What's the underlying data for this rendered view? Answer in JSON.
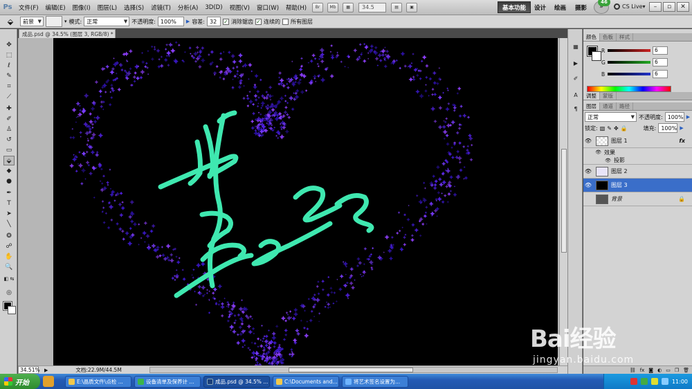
{
  "app": {
    "logo": "Ps"
  },
  "menu": {
    "items": [
      "文件(F)",
      "编辑(E)",
      "图像(I)",
      "图层(L)",
      "选择(S)",
      "滤镜(T)",
      "分析(A)",
      "3D(D)",
      "视图(V)",
      "窗口(W)",
      "帮助(H)"
    ],
    "zoom_value": "34.5",
    "workspace_essentials": "基本功能",
    "workspaces": [
      "设计",
      "绘画",
      "摄影"
    ],
    "more_label": "»",
    "badge": "46",
    "cslive": "CS Live▾"
  },
  "options": {
    "mode_select": "前景",
    "mode_label": "模式:",
    "mode_value": "正常",
    "opacity_label": "不透明度:",
    "opacity_value": "100%",
    "tolerance_label": "容差:",
    "tolerance_value": "32",
    "antialias_label": "消除锯齿",
    "contiguous_label": "连续的",
    "all_layers_label": "所有图层"
  },
  "document": {
    "tab_title": "成品.psd @ 34.5% (图层 3, RGB/8) *",
    "status_zoom": "34.51%",
    "status_doc": "文档:22.9M/44.5M",
    "signature_text": "美22"
  },
  "color_panel": {
    "tabs": [
      "颜色",
      "色板",
      "样式"
    ],
    "r_label": "R",
    "g_label": "G",
    "b_label": "B",
    "r_value": "6",
    "g_value": "6",
    "b_value": "6",
    "r_color": "#cc2222",
    "g_color": "#22aa22",
    "b_color": "#2233cc"
  },
  "adjust_panel": {
    "tabs": [
      "调整",
      "蒙版"
    ]
  },
  "layers_panel": {
    "tabs": [
      "图层",
      "通道",
      "路径"
    ],
    "blend_mode": "正常",
    "opacity_label": "不透明度:",
    "opacity_value": "100%",
    "lock_label": "锁定:",
    "fill_label": "填充:",
    "fill_value": "100%",
    "layers": [
      {
        "name": "图层 1",
        "fx": "fx"
      },
      {
        "name": "效果"
      },
      {
        "name": "投影"
      },
      {
        "name": "图层 2"
      },
      {
        "name": "图层 3"
      },
      {
        "name": "背景"
      }
    ]
  },
  "taskbar": {
    "start_label": "开始",
    "tasks": [
      "E:\\晶质文件\\点检 ...",
      "设备清单及保养计 ...",
      "成品.psd @ 34.5% ...",
      "C:\\Documents and...",
      "将艺术签名设置为..."
    ],
    "clock": "11:00"
  },
  "watermark": {
    "logo": "Bai经验",
    "url": "jingyan.baidu.com"
  },
  "colors": {
    "signature": "#3fe8b0",
    "heart_dark": "#3a18c8",
    "heart_light": "#7a3cff",
    "selection_blue": "#3a6ec9"
  }
}
